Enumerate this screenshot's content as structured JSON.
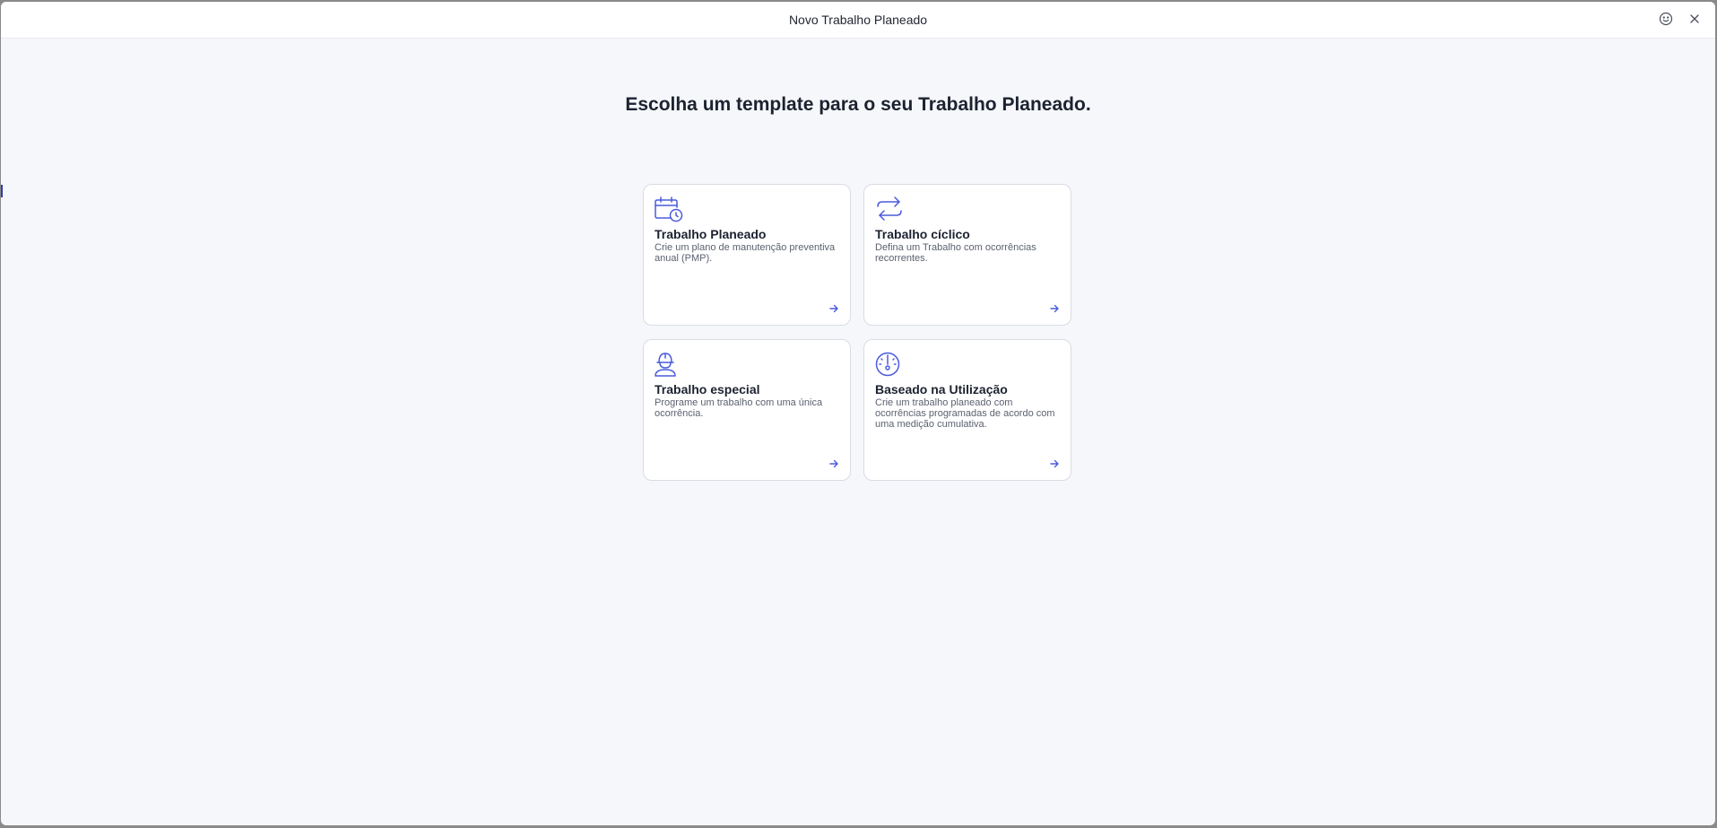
{
  "window": {
    "title": "Novo Trabalho Planeado",
    "feedback_icon": "smiley-feedback-icon",
    "close_icon": "close-icon"
  },
  "main": {
    "heading": "Escolha um template para o seu Trabalho Planeado.",
    "accent_color": "#4a5bdc",
    "cards": [
      {
        "icon": "calendar-clock-icon",
        "title": "Trabalho Planeado",
        "description": "Crie um plano de manutenção preventiva anual (PMP)."
      },
      {
        "icon": "repeat-icon",
        "title": "Trabalho cíclico",
        "description": "Defina um Trabalho com ocorrências recorrentes."
      },
      {
        "icon": "worker-helmet-icon",
        "title": "Trabalho especial",
        "description": "Programe um trabalho com uma única ocorrência."
      },
      {
        "icon": "gauge-icon",
        "title": "Baseado na Utilização",
        "description": "Crie um trabalho planeado com ocorrências programadas de acordo com uma medição cumulativa."
      }
    ]
  }
}
